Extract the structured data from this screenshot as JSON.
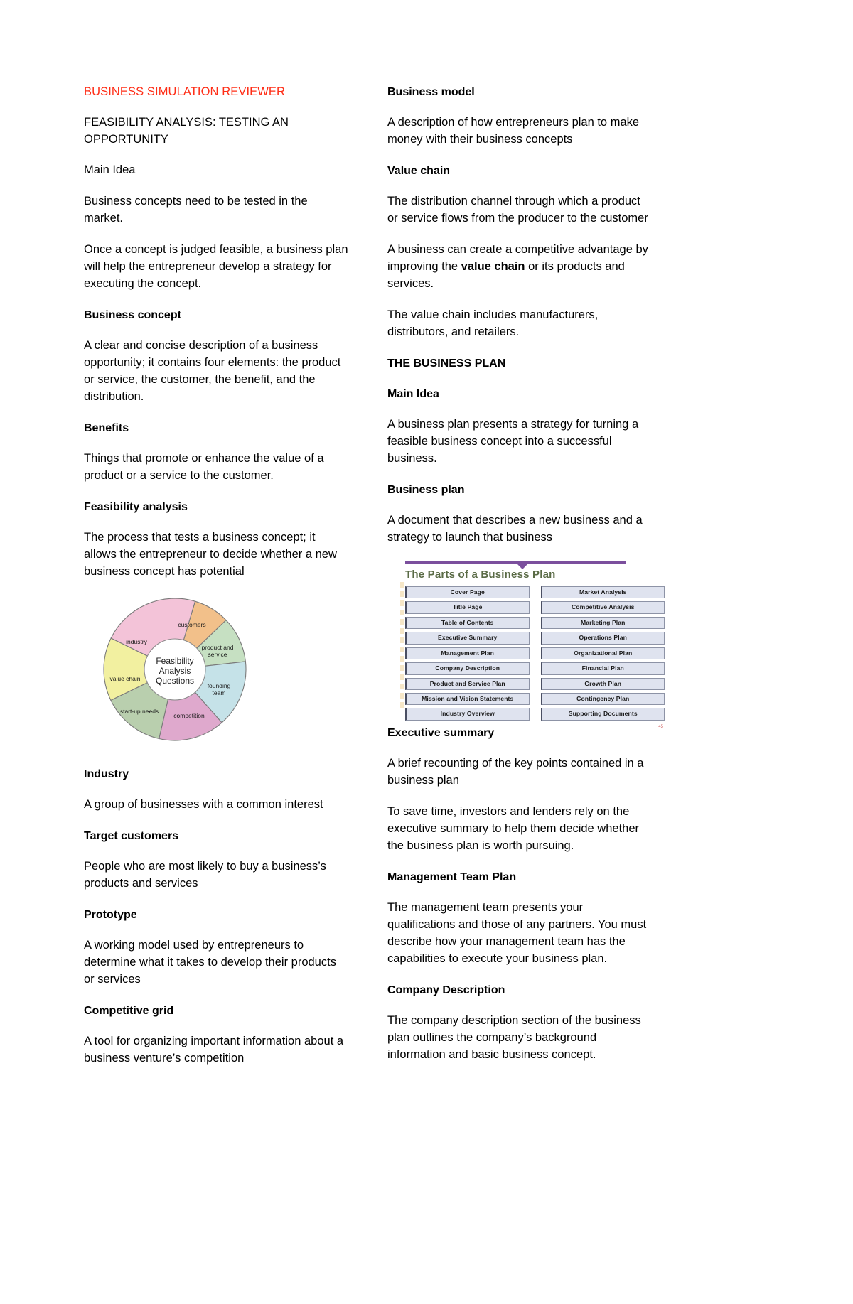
{
  "document": {
    "title": "BUSINESS SIMULATION REVIEWER",
    "title_color": "#ff2d16",
    "subtitle": "FEASIBILITY ANALYSIS: TESTING AN OPPORTUNITY"
  },
  "left_column": {
    "main_idea_heading": "Main Idea",
    "main_idea_p1": "Business concepts need to be tested in the market.",
    "main_idea_p2": "Once a concept is judged feasible, a business plan will help the entrepreneur develop a strategy for executing the concept.",
    "terms": [
      {
        "term": "Business concept",
        "definition": "A clear and concise description of a business opportunity; it contains four elements: the product or service, the customer, the benefit, and the distribution."
      },
      {
        "term": "Benefits",
        "definition": "Things that promote or enhance the value of a product or a service to the customer."
      },
      {
        "term": "Feasibility analysis",
        "definition": "The process that tests a business concept; it allows the entrepreneur to decide whether a new business concept has potential"
      }
    ],
    "terms_after_wheel": [
      {
        "term": "Industry",
        "definition": "A group of businesses with a common interest"
      },
      {
        "term": "Target customers",
        "definition": "People who are most likely to buy a business’s products and services"
      },
      {
        "term": "Prototype",
        "definition": "A working model used by entrepreneurs to determine what it takes to develop their products or services"
      },
      {
        "term": "Competitive grid",
        "definition": "A tool for organizing important information about a business venture’s competition"
      }
    ]
  },
  "right_column": {
    "terms_top": [
      {
        "term": "Business model",
        "definition": "A description of how entrepreneurs plan to make money with their business concepts"
      },
      {
        "term": "Value chain",
        "definition": "The distribution channel through which a product or service flows from the producer to the customer"
      }
    ],
    "value_chain_p2_a": "A business can create a competitive advantage by improving the ",
    "value_chain_p2_bold": "value chain",
    "value_chain_p2_b": " or its products and services.",
    "value_chain_p3": "The value chain includes manufacturers, distributors, and retailers.",
    "business_plan_section_heading": "THE BUSINESS PLAN",
    "main_idea_heading": "Main Idea",
    "main_idea_p1": "A business plan presents a strategy for turning a feasible business concept into a successful business.",
    "business_plan_term": "Business plan",
    "business_plan_def": "A document that describes a new business and a strategy to launch that business",
    "terms_after_figure": [
      {
        "term": "Executive summary",
        "definition": "A brief recounting of the key points contained in a business plan",
        "definition2": "To save time, investors and lenders rely on the executive summary to help them decide whether the business plan is worth pursuing."
      },
      {
        "term": "Management Team Plan",
        "definition": "The management team presents your qualifications and those of any partners. You must describe how your management team has the capabilities to execute your business plan."
      },
      {
        "term": "Company Description",
        "definition": "The company description section of the business plan outlines the company’s background information and basic business concept."
      }
    ]
  },
  "chart_data": {
    "type": "pie",
    "title": "Feasibility Analysis Questions",
    "center_label_lines": [
      "Feasibility",
      "Analysis",
      "Questions"
    ],
    "categories": [
      "customers",
      "product and service",
      "founding team",
      "competition",
      "start-up needs",
      "value chain",
      "industry"
    ],
    "values": [
      1,
      1,
      1,
      1,
      1,
      1,
      1
    ],
    "colors": [
      "#f2c08a",
      "#c6e0c2",
      "#c5e2e8",
      "#dfa9cd",
      "#b9cfae",
      "#f2f0a0",
      "#f3c3d8"
    ],
    "legend": "none",
    "grid": false
  },
  "plan_figure": {
    "title": "The Parts of a Business Plan",
    "page_number": "45",
    "accent_color": "#7b4f9d",
    "title_color": "#5a6b46",
    "left_items": [
      "Cover Page",
      "Title Page",
      "Table of Contents",
      "Executive Summary",
      "Management Plan",
      "Company Description",
      "Product and Service Plan",
      "Mission and Vision Statements",
      "Industry Overview"
    ],
    "right_items": [
      "Market Analysis",
      "Competitive Analysis",
      "Marketing Plan",
      "Operations Plan",
      "Organizational Plan",
      "Financial Plan",
      "Growth Plan",
      "Contingency Plan",
      "Supporting Documents"
    ]
  }
}
